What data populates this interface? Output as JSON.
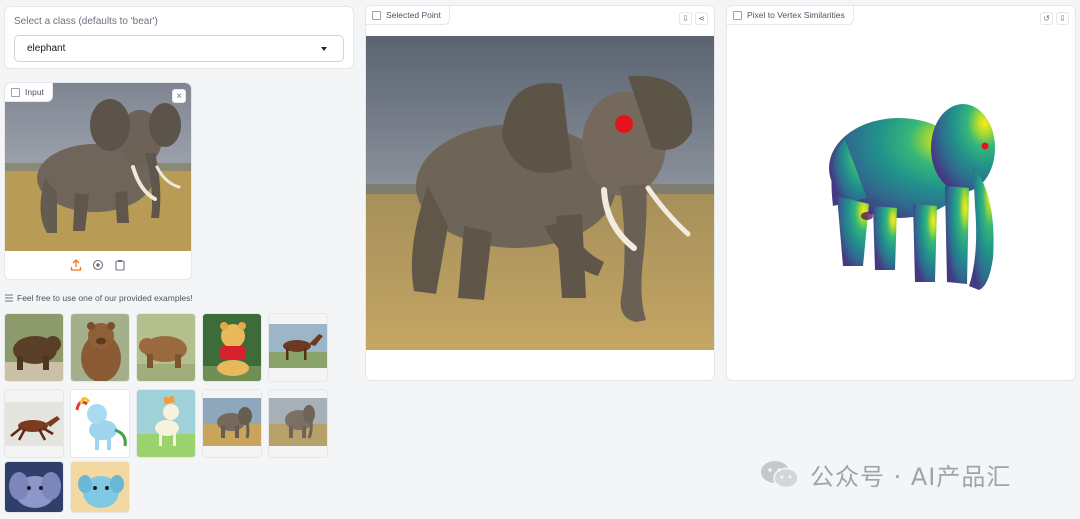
{
  "class_select": {
    "label": "Select a class (defaults to 'bear')",
    "value": "elephant",
    "arrow_icon": "dropdown-arrow-icon"
  },
  "input_panel": {
    "label": "Input",
    "close_icon": "close-icon",
    "tools": [
      "upload-icon",
      "webcam-icon",
      "clipboard-icon"
    ]
  },
  "examples": {
    "label": "Feel free to use one of our provided examples!",
    "items": [
      "bear-photo",
      "brown-bear-photo",
      "grizzly-bear-photo",
      "winnie-the-pooh-photo",
      "horse-photo",
      "running-horse-photo",
      "rainbow-pony-cartoon",
      "ponyta-cartoon",
      "elephant-photo",
      "elephant-grazing-photo",
      "dumbo-cartoon",
      "cartoon-creature"
    ]
  },
  "selected_point": {
    "label": "Selected Point",
    "actions": [
      "download-icon",
      "share-icon"
    ],
    "marker_color": "#e3141b"
  },
  "similarities": {
    "label": "Pixel to Vertex Similarities",
    "actions": [
      "reset-icon",
      "download-icon"
    ]
  },
  "watermark": {
    "text": "公众号 · AI产品汇"
  }
}
